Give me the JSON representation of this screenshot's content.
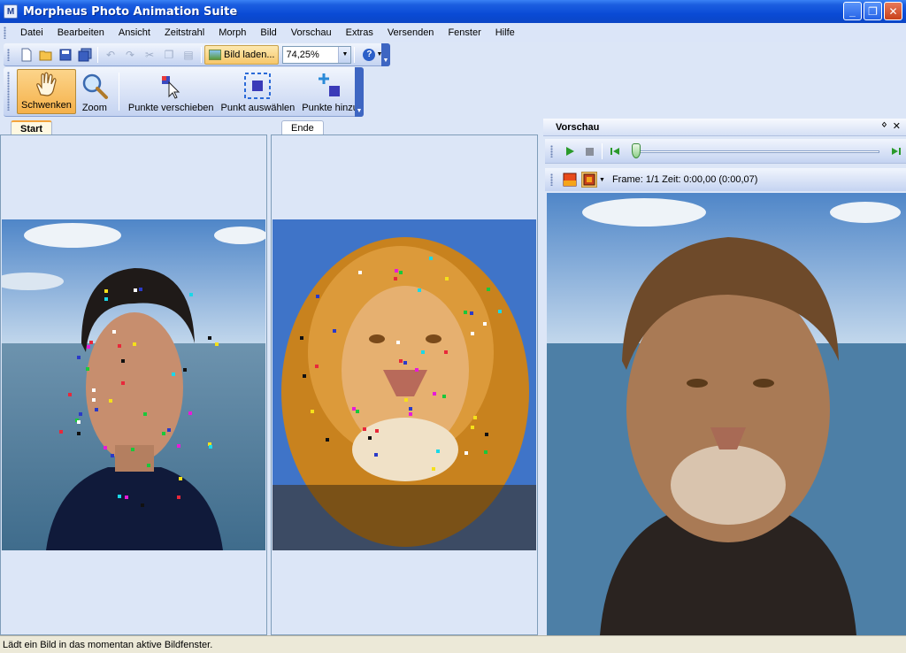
{
  "window": {
    "title": "Morpheus Photo Animation Suite"
  },
  "menu": [
    "Datei",
    "Bearbeiten",
    "Ansicht",
    "Zeitstrahl",
    "Morph",
    "Bild",
    "Vorschau",
    "Extras",
    "Versenden",
    "Fenster",
    "Hilfe"
  ],
  "toolbar": {
    "icons": [
      "new-file-icon",
      "open-folder-icon",
      "save-icon",
      "save-all-icon",
      "undo-icon",
      "redo-icon",
      "cut-icon",
      "copy-icon",
      "paste-icon"
    ],
    "load_image_label": "Bild laden...",
    "zoom_value": "74,25%"
  },
  "tools": [
    {
      "label": "Schwenken",
      "icon": "hand-icon",
      "active": true
    },
    {
      "label": "Zoom",
      "icon": "magnifier-icon",
      "active": false
    },
    {
      "label": "Punkte verschieben",
      "icon": "move-points-icon",
      "active": false
    },
    {
      "label": "Punkt auswählen",
      "icon": "select-point-icon",
      "active": false
    },
    {
      "label": "Punkte hinzu",
      "icon": "add-points-icon",
      "active": false
    }
  ],
  "panels": {
    "start": {
      "tab": "Start"
    },
    "end": {
      "tab": "Ende"
    }
  },
  "preview": {
    "title": "Vorschau",
    "pin_icon": "pin-icon",
    "close_icon": "close-icon",
    "slider_position": 0,
    "frame_info": "Frame: 1/1 Zeit: 0:00,00 (0:00,07)"
  },
  "status": {
    "text": "Lädt ein Bild in das momentan aktive Bildfenster."
  },
  "colors": {
    "accent": "#0a4bd6",
    "active_tool": "#f5b14a",
    "sky": "#6fa2d6",
    "sea": "#4d7fa6"
  }
}
